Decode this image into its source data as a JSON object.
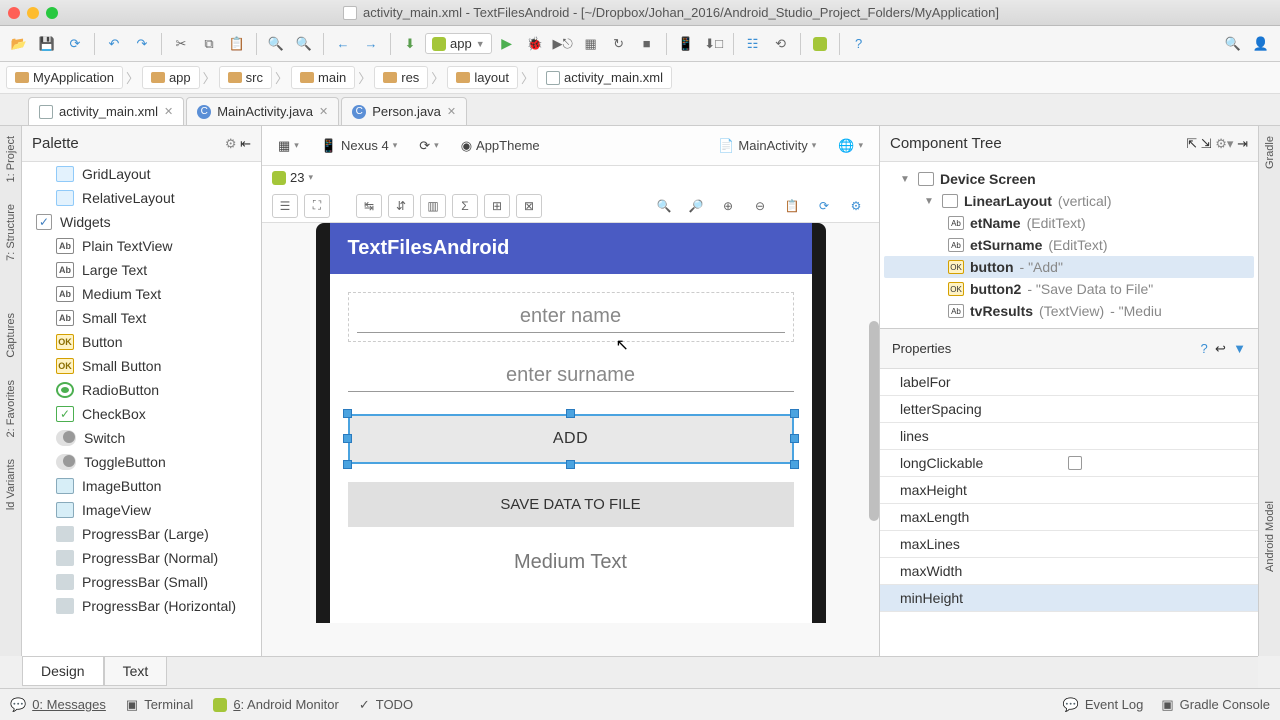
{
  "window_title": "activity_main.xml - TextFilesAndroid - [~/Dropbox/Johan_2016/Android_Studio_Project_Folders/MyApplication]",
  "module_selector": "app",
  "breadcrumbs": [
    "MyApplication",
    "app",
    "src",
    "main",
    "res",
    "layout",
    "activity_main.xml"
  ],
  "editor_tabs": [
    {
      "label": "activity_main.xml",
      "active": true,
      "kind": "xml"
    },
    {
      "label": "MainActivity.java",
      "active": false,
      "kind": "c"
    },
    {
      "label": "Person.java",
      "active": false,
      "kind": "c"
    }
  ],
  "left_strip": [
    "1: Project",
    "7: Structure",
    "Captures",
    "2: Favorites",
    "ld Variants"
  ],
  "right_strip": [
    "Gradle",
    "Android Model"
  ],
  "palette_title": "Palette",
  "palette_items": [
    {
      "label": "GridLayout",
      "icon": "layout",
      "cat": false
    },
    {
      "label": "RelativeLayout",
      "icon": "layout",
      "cat": false
    },
    {
      "label": "Widgets",
      "icon": "cat",
      "cat": true,
      "checked": true
    },
    {
      "label": "Plain TextView",
      "icon": "ab"
    },
    {
      "label": "Large Text",
      "icon": "ab"
    },
    {
      "label": "Medium Text",
      "icon": "ab"
    },
    {
      "label": "Small Text",
      "icon": "ab"
    },
    {
      "label": "Button",
      "icon": "ok"
    },
    {
      "label": "Small Button",
      "icon": "ok"
    },
    {
      "label": "RadioButton",
      "icon": "radio"
    },
    {
      "label": "CheckBox",
      "icon": "check"
    },
    {
      "label": "Switch",
      "icon": "switch"
    },
    {
      "label": "ToggleButton",
      "icon": "switch"
    },
    {
      "label": "ImageButton",
      "icon": "img"
    },
    {
      "label": "ImageView",
      "icon": "img"
    },
    {
      "label": "ProgressBar (Large)",
      "icon": "bar"
    },
    {
      "label": "ProgressBar (Normal)",
      "icon": "bar"
    },
    {
      "label": "ProgressBar (Small)",
      "icon": "bar"
    },
    {
      "label": "ProgressBar (Horizontal)",
      "icon": "bar"
    }
  ],
  "designer_toolbar": {
    "device": "Nexus 4",
    "theme": "AppTheme",
    "activity": "MainActivity",
    "api": "23"
  },
  "preview": {
    "app_title": "TextFilesAndroid",
    "hint1": "enter name",
    "hint2": "enter surname",
    "btn1": "ADD",
    "btn2": "SAVE DATA TO FILE",
    "tv": "Medium Text"
  },
  "tree_title": "Component Tree",
  "tree": [
    {
      "depth": 0,
      "name": "Device Screen",
      "type": "",
      "icon": "dev"
    },
    {
      "depth": 1,
      "name": "LinearLayout",
      "type": "(vertical)",
      "icon": "layout"
    },
    {
      "depth": 2,
      "name": "etName",
      "type": "(EditText)",
      "icon": "ab"
    },
    {
      "depth": 2,
      "name": "etSurname",
      "type": "(EditText)",
      "icon": "ab"
    },
    {
      "depth": 2,
      "name": "button",
      "type": "",
      "val": "- \"Add\"",
      "icon": "ok",
      "sel": true
    },
    {
      "depth": 2,
      "name": "button2",
      "type": "",
      "val": "- \"Save Data to File\"",
      "icon": "ok"
    },
    {
      "depth": 2,
      "name": "tvResults",
      "type": "(TextView)",
      "val": "- \"Mediu",
      "icon": "ab"
    }
  ],
  "props_title": "Properties",
  "properties": [
    {
      "name": "labelFor",
      "val": ""
    },
    {
      "name": "letterSpacing",
      "val": ""
    },
    {
      "name": "lines",
      "val": ""
    },
    {
      "name": "longClickable",
      "val": "",
      "check": true
    },
    {
      "name": "maxHeight",
      "val": ""
    },
    {
      "name": "maxLength",
      "val": ""
    },
    {
      "name": "maxLines",
      "val": ""
    },
    {
      "name": "maxWidth",
      "val": ""
    },
    {
      "name": "minHeight",
      "val": "",
      "sel": true
    }
  ],
  "design_tabs": [
    "Design",
    "Text"
  ],
  "status_left": [
    {
      "label": "0: Messages"
    },
    {
      "label": "Terminal"
    },
    {
      "label": "6: Android Monitor"
    },
    {
      "label": "TODO"
    }
  ],
  "status_right": [
    "Event Log",
    "Gradle Console"
  ]
}
